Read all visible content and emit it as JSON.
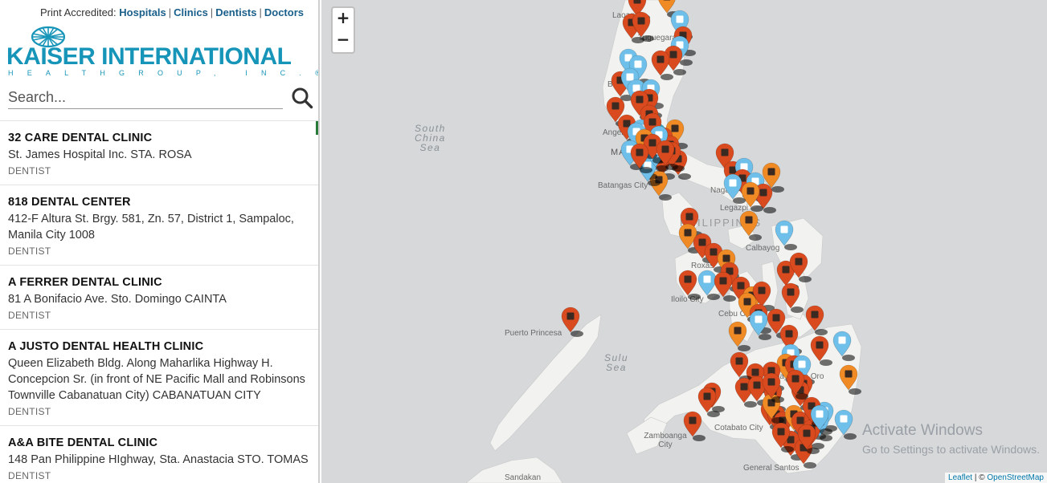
{
  "print_bar": {
    "prefix": "Print Accredited:",
    "links": [
      "Hospitals",
      "Clinics",
      "Dentists",
      "Doctors"
    ],
    "separator": "|"
  },
  "logo": {
    "name": "KAISER INTERNATIONAL",
    "sub": "HEALTHGROUP, INC.",
    "mark": "®"
  },
  "search": {
    "placeholder": "Search..."
  },
  "list": [
    {
      "name": "32 CARE DENTAL CLINIC",
      "address": "St. James Hospital Inc. STA. ROSA",
      "type": "DENTIST"
    },
    {
      "name": "818 DENTAL CENTER",
      "address": "412-F Altura St. Brgy. 581, Zn. 57, District 1, Sampaloc, Manila City 1008",
      "type": "DENTIST"
    },
    {
      "name": "A FERRER DENTAL CLINIC",
      "address": "81 A Bonifacio Ave. Sto. Domingo CAINTA",
      "type": "DENTIST"
    },
    {
      "name": "A JUSTO DENTAL HEALTH CLINIC",
      "address": "Queen Elizabeth Bldg. Along Maharlika Highway H. Concepcion Sr. (in front of NE Pacific Mall and Robinsons Townville Cabanatuan City) CABANATUAN CITY",
      "type": "DENTIST"
    },
    {
      "name": "A&A BITE DENTAL CLINIC",
      "address": "148 Pan Philippine HIghway, Sta. Anastacia STO. TOMAS",
      "type": "DENTIST"
    }
  ],
  "map": {
    "zoom_in": "+",
    "zoom_out": "−",
    "seas": [
      {
        "lines": [
          "South",
          "China",
          "Sea"
        ]
      },
      {
        "lines": [
          "Sulu",
          "Sea"
        ]
      }
    ],
    "country_label": "PHILIPPINES",
    "places": [
      "Laoag",
      "Tuguegarao",
      "Baguio",
      "Angeles",
      "MANILA",
      "Batangas City",
      "Naga",
      "Legazpi",
      "Calbayog",
      "Roxas",
      "Iloilo City",
      "Cebu City",
      "Puerto Princesa",
      "Cagayan de Oro",
      "Cotabato City",
      "Zamboanga City",
      "General Santos",
      "Sandakan"
    ],
    "activate_title": "Activate Windows",
    "activate_sub": "Go to Settings to activate Windows.",
    "attribution_leaflet": "Leaflet",
    "attribution_sep": "| ©",
    "attribution_osm": "OpenStreetMap"
  },
  "colors": {
    "brand": "#1795b9",
    "link": "#1a5f8a",
    "marker_hospital": "#d94a1e",
    "marker_clinic": "#f08a24",
    "marker_dentist": "#6ec0ea",
    "cluster": "#2e9bb5",
    "land": "#f2f2f0",
    "water": "#d6d8da"
  },
  "markers": {
    "hospital": 70,
    "clinic": 24,
    "dentist": 26
  }
}
